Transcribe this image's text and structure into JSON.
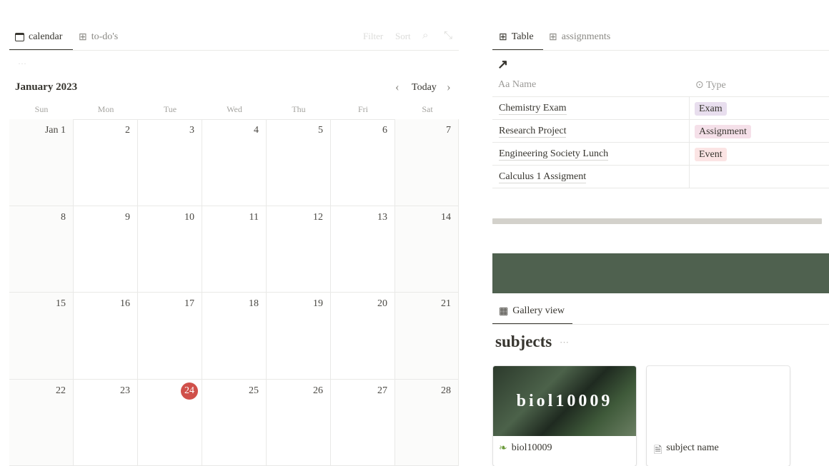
{
  "calendar_panel": {
    "tabs": [
      {
        "label": "calendar",
        "icon": "calendar-icon"
      },
      {
        "label": "to-do's",
        "icon": "table-icon"
      }
    ],
    "toolbar": {
      "filter": "Filter",
      "sort": "Sort"
    },
    "more": "···",
    "month": "January 2023",
    "today": "Today",
    "weekdays": [
      "Sun",
      "Mon",
      "Tue",
      "Wed",
      "Thu",
      "Fri",
      "Sat"
    ],
    "weeks": [
      [
        "Jan 1",
        "2",
        "3",
        "4",
        "5",
        "6",
        "7"
      ],
      [
        "8",
        "9",
        "10",
        "11",
        "12",
        "13",
        "14"
      ],
      [
        "15",
        "16",
        "17",
        "18",
        "19",
        "20",
        "21"
      ],
      [
        "22",
        "23",
        "24",
        "25",
        "26",
        "27",
        "28"
      ]
    ],
    "today_date": "24",
    "today_color": "#d0504a"
  },
  "table_panel": {
    "tabs": [
      {
        "label": "Table",
        "icon": "table-icon"
      },
      {
        "label": "assignments",
        "icon": "table-icon"
      }
    ],
    "columns": [
      {
        "label": "Name",
        "icon": "Aa"
      },
      {
        "label": "Type",
        "icon": "select-icon"
      }
    ],
    "rows": [
      {
        "name": "Chemistry Exam",
        "type": "Exam",
        "color": "#e8deee"
      },
      {
        "name": "Research Project",
        "type": "Assignment",
        "color": "#f5e0e9"
      },
      {
        "name": "Engineering Society Lunch",
        "type": "Event",
        "color": "#fbe4e4"
      },
      {
        "name": "Calculus 1 Assigment",
        "type": "",
        "color": ""
      }
    ]
  },
  "banner_color": "#4f614f",
  "gallery": {
    "tab": "Gallery view",
    "title": "subjects",
    "more": "···",
    "cards": [
      {
        "title": "biol10009",
        "cover_text": "biol10009",
        "icon": "leaf-icon"
      },
      {
        "title": "subject name",
        "icon": "page-icon"
      }
    ]
  }
}
